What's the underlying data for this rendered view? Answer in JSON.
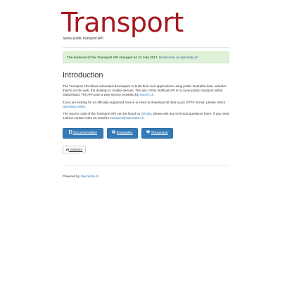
{
  "header": {
    "title": "Transport",
    "subtitle": "Swiss public transport API"
  },
  "notice": {
    "text": "The backend of the Transport API changed on 31 July 2017.",
    "link": "Read more on opendata.ch."
  },
  "intro": {
    "heading": "Introduction",
    "p1_text": "The Transport API allows interested developers to build their own applications using public timetable data, whether they're on the web, the desktop or mobile devices. The aim of this inofficial API is to cover public transport within Switzerland. The API uses a web service provided by ",
    "p1_link": "search.ch",
    "p1_end": ".",
    "p2_text": "If you are looking for an officially supported source or need to download all data e.g in GTFS format, please check ",
    "p2_link": "opendata.swiss",
    "p2_end": ".",
    "p3_text": "The source code of the Transport API can be found on ",
    "p3_link1": "GitHub",
    "p3_mid": ", please ask any technical questions there. If you need a direct contact write an email to ",
    "p3_link2": "transport@opendata.ch",
    "p3_end": "."
  },
  "buttons": {
    "documentation": "Documentation",
    "examples": "Examples",
    "showcase": "Showcase",
    "statistics": "Statistics"
  },
  "footer": {
    "prefix": "Powered by ",
    "link": "Opendata.ch"
  },
  "colors": {
    "title": "#a5191e",
    "primary_button": "#337ab7",
    "alert_bg": "#dff0d8",
    "link": "#337ab7"
  },
  "icons": {
    "documentation": "book-icon",
    "examples": "plus-circle-icon",
    "showcase": "screen-icon",
    "statistics": "bar-chart-icon"
  }
}
